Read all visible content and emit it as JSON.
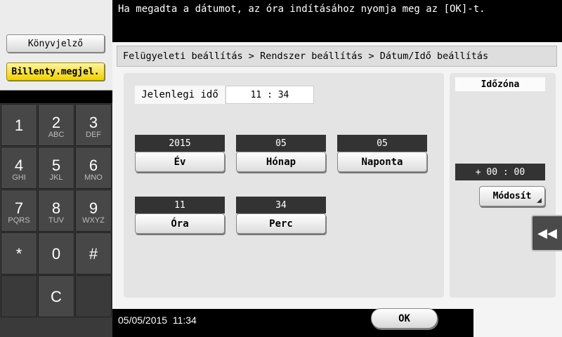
{
  "message": "Ha megadta a dátumot, az óra indításához nyomja meg az  [OK]-t.",
  "sidebar": {
    "bookmark_label": "Könyvjelző",
    "keyboard_label": "Billenty.megjel."
  },
  "keypad": {
    "k1": "1",
    "k2": "2",
    "k2_sub": "ABC",
    "k3": "3",
    "k3_sub": "DEF",
    "k4": "4",
    "k4_sub": "GHI",
    "k5": "5",
    "k5_sub": "JKL",
    "k6": "6",
    "k6_sub": "MNO",
    "k7": "7",
    "k7_sub": "PQRS",
    "k8": "8",
    "k8_sub": "TUV",
    "k9": "9",
    "k9_sub": "WXYZ",
    "star": "*",
    "k0": "0",
    "hash": "#",
    "clear": "C"
  },
  "breadcrumb": "Felügyeleti beállítás > Rendszer beállítás > Dátum/Idő beállítás",
  "current_time": {
    "label": "Jelenlegi idő",
    "value": "11 : 34"
  },
  "fields": {
    "year": {
      "value": "2015",
      "label": "Év"
    },
    "month": {
      "value": "05",
      "label": "Hónap"
    },
    "day": {
      "value": "05",
      "label": "Naponta"
    },
    "hour": {
      "value": "11",
      "label": "Óra"
    },
    "minute": {
      "value": "34",
      "label": "Perc"
    }
  },
  "timezone": {
    "label": "Időzóna",
    "value": "+ 00 : 00",
    "modify_label": "Módosít"
  },
  "footer": {
    "datetime": "05/05/2015  11:34",
    "ok_label": "OK"
  },
  "collapse_icon": "double-chevron-left-icon"
}
